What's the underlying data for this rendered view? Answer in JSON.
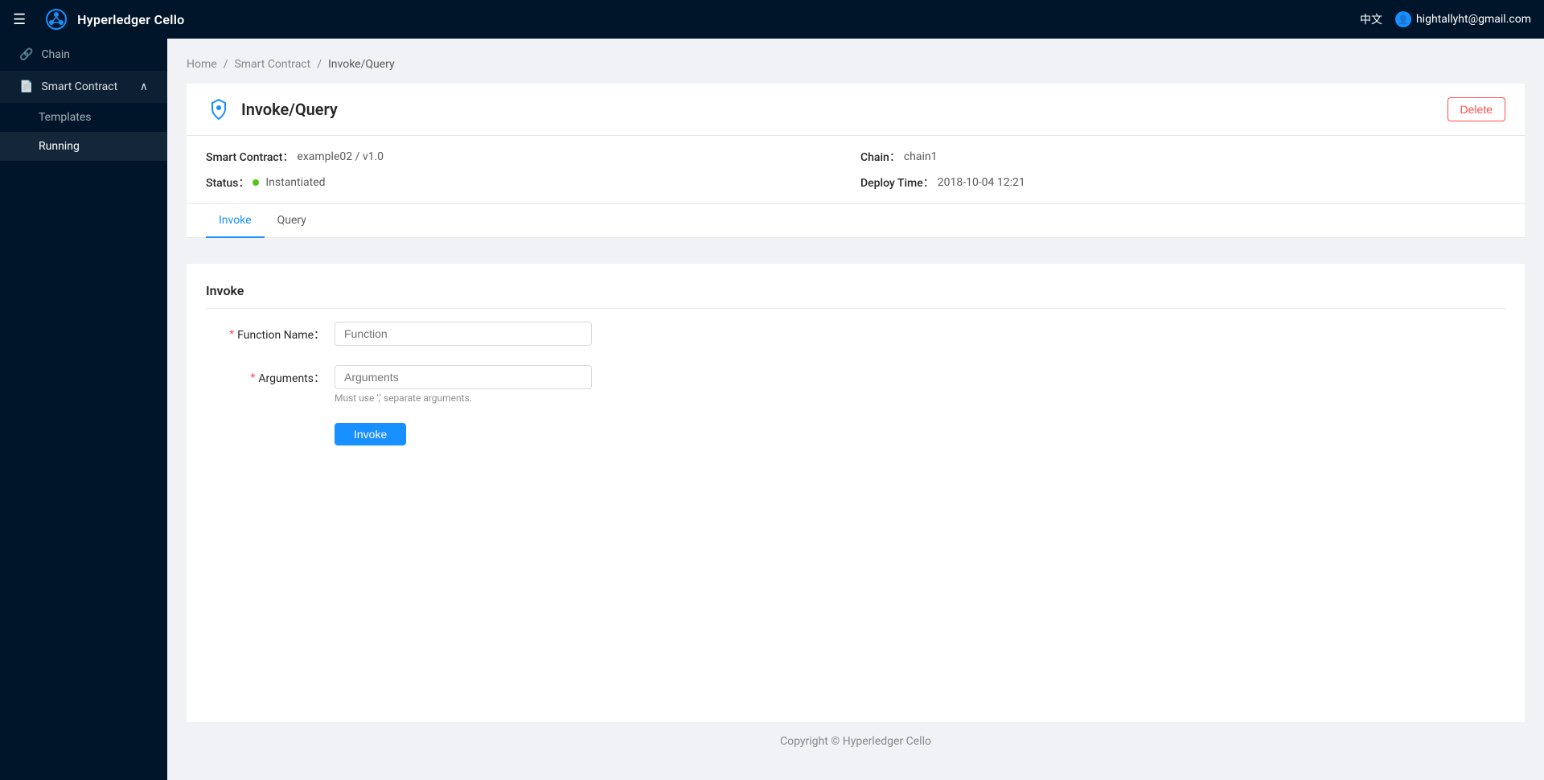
{
  "app": {
    "title": "Hyperledger Cello",
    "lang_switch": "中文",
    "user_email": "hightallyht@gmail.com"
  },
  "sidebar": {
    "menu_icon": "☰",
    "items": [
      {
        "id": "chain",
        "label": "Chain",
        "icon": "🔗",
        "active": false
      },
      {
        "id": "smart-contract",
        "label": "Smart Contract",
        "icon": "📄",
        "expanded": true,
        "sub_items": [
          {
            "id": "templates",
            "label": "Templates",
            "active": false
          },
          {
            "id": "running",
            "label": "Running",
            "active": true
          }
        ]
      }
    ]
  },
  "breadcrumb": {
    "items": [
      "Home",
      "Smart Contract",
      "Invoke/Query"
    ]
  },
  "page": {
    "title": "Invoke/Query",
    "delete_button": "Delete"
  },
  "contract_info": {
    "smart_contract_label": "Smart Contract：",
    "smart_contract_value": "example02 / v1.0",
    "chain_label": "Chain：",
    "chain_value": "chain1",
    "status_label": "Status：",
    "status_value": "Instantiated",
    "deploy_time_label": "Deploy Time：",
    "deploy_time_value": "2018-10-04 12:21"
  },
  "tabs": [
    {
      "id": "invoke",
      "label": "Invoke",
      "active": true
    },
    {
      "id": "query",
      "label": "Query",
      "active": false
    }
  ],
  "invoke_panel": {
    "title": "Invoke",
    "function_name_label": "Function Name：",
    "function_name_placeholder": "Function",
    "arguments_label": "Arguments：",
    "arguments_placeholder": "Arguments",
    "arguments_hint": "Must use ',' separate arguments.",
    "invoke_button": "Invoke"
  },
  "footer": {
    "text": "Copyright © Hyperledger Cello"
  },
  "colors": {
    "primary": "#1890ff",
    "danger": "#ff4d4f",
    "success": "#52c41a",
    "sidebar_bg": "#001529"
  }
}
